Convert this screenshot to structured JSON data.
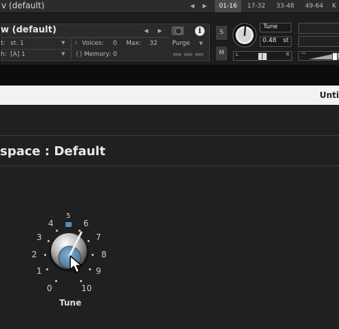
{
  "topbar": {
    "title": "v (default)",
    "tabs": [
      "01-16",
      "17-32",
      "33-48",
      "49-64",
      "K"
    ]
  },
  "instrument": {
    "name": "w (default)",
    "output_label": "t:",
    "output_value": "st. 1",
    "midi_label": "h:",
    "midi_value": "[A] 1",
    "voices_label": "Voices:",
    "voices_value": "0",
    "max_label": "Max:",
    "max_value": "32",
    "memory_label": "Memory:",
    "memory_value": "0",
    "purge_label": "Purge",
    "solo_label": "S",
    "mute_label": "M",
    "tune_label": "Tune",
    "tune_value": "0.48",
    "tune_unit": "st",
    "pan_left": "L",
    "pan_right": "R",
    "vol_minus": "−"
  },
  "page": {
    "untitled_label": "Unti",
    "panel_title": "space : Default"
  },
  "knob": {
    "label": "Tune",
    "scale": [
      "0",
      "1",
      "2",
      "3",
      "4",
      "5",
      "6",
      "7",
      "8",
      "9",
      "10"
    ],
    "value": 5.5
  },
  "colors": {
    "accent_blue": "#5b8bb0",
    "background": "#202020"
  }
}
